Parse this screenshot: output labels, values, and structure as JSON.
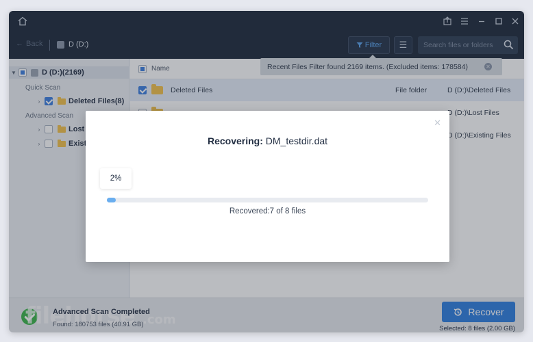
{
  "header": {
    "back_label": "Back",
    "drive_crumb": "D (D:)",
    "filter_label": "Filter",
    "search_placeholder": "Search files or folders"
  },
  "tree": {
    "root_label": "D (D:)(2169)",
    "quick_scan_label": "Quick Scan",
    "deleted_files_label": "Deleted Files(8)",
    "advanced_scan_label": "Advanced Scan",
    "lost_label": "Lost F",
    "existing_label": "Existi"
  },
  "list": {
    "name_header": "Name",
    "rows": [
      {
        "name": "Deleted Files",
        "type": "File folder",
        "path": "D (D:)\\Deleted Files"
      },
      {
        "name": "",
        "type": "",
        "path": "D (D:)\\Lost Files"
      },
      {
        "name": "",
        "type": "",
        "path": "D (D:)\\Existing Files"
      }
    ]
  },
  "toast": {
    "text": "Recent Files Filter found 2169 items. (Excluded items: 178584)"
  },
  "modal": {
    "title_prefix": "Recovering:",
    "title_file": "DM_testdir.dat",
    "percent_label": "2%",
    "progress_fraction": 0.02,
    "recovered_text": "Recovered:7 of 8 files"
  },
  "status": {
    "title": "Advanced Scan Completed",
    "found": "Found: 180753 files (40.91 GB)",
    "recover_label": "Recover",
    "selected_info": "Selected: 8 files (2.00 GB)",
    "watermark": "filehorse",
    "watermark_suffix": ".com"
  },
  "colors": {
    "accent": "#2f7fe0",
    "titlebar": "#1e2a3c",
    "success": "#3bb54a",
    "folder": "#f3c24a"
  }
}
